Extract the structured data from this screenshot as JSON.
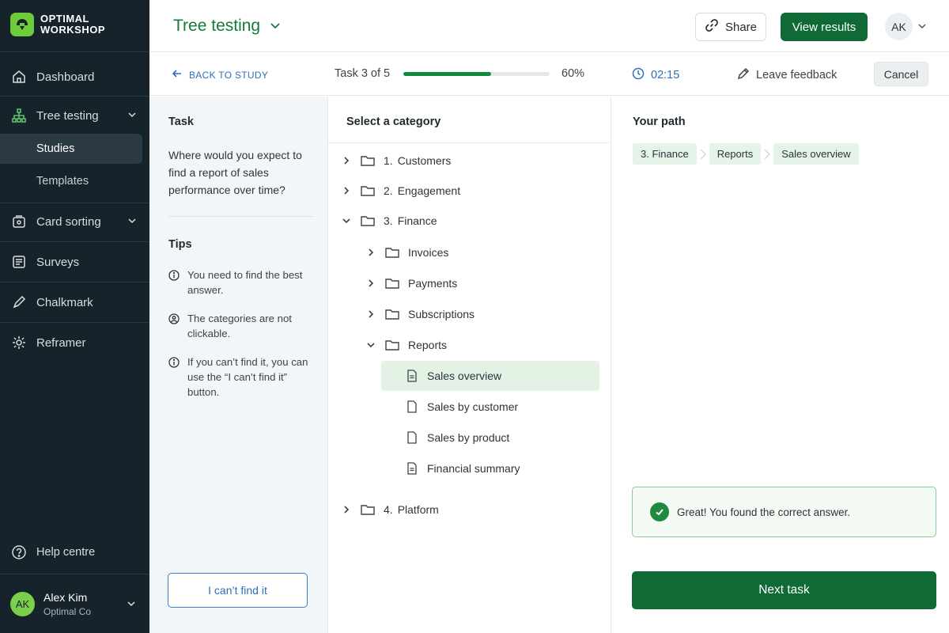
{
  "brand": {
    "line1": "OPTIMAL",
    "line2": "WORKSHOP"
  },
  "sidebar": {
    "items": [
      {
        "label": "Dashboard",
        "icon": "home-icon"
      },
      {
        "label": "Tree testing",
        "icon": "tree-icon"
      },
      {
        "label": "Card sorting",
        "icon": "cards-icon"
      },
      {
        "label": "Surveys",
        "icon": "survey-icon"
      },
      {
        "label": "Chalkmark",
        "icon": "pen-icon"
      },
      {
        "label": "Reframer",
        "icon": "reframer-icon"
      }
    ],
    "tree_sub": [
      {
        "label": "Studies"
      },
      {
        "label": "Templates"
      }
    ],
    "help": "Help centre",
    "user": {
      "initials": "AK",
      "name": "Alex Kim",
      "org": "Optimal Co"
    }
  },
  "header": {
    "title": "Tree testing",
    "share": "Share",
    "view_results": "View results",
    "avatar": "AK"
  },
  "subbar": {
    "back": "BACK TO STUDY",
    "task": "Task 3 of 5",
    "progress": 0.6,
    "progress_label": "60%",
    "timer": "02:15",
    "feedback": "Leave feedback",
    "cancel": "Cancel"
  },
  "task_panel": {
    "heading": "Task",
    "text": "Where would you expect to find a report of sales performance over time?",
    "tips_heading": "Tips",
    "tips": [
      "You need to find the best answer.",
      "The categories are not clickable.",
      "If you can’t find it, you can use the “I can’t find it” button."
    ],
    "cant_find": "I can’t find it"
  },
  "tree": {
    "heading": "Select a category",
    "items": [
      {
        "num": "1.",
        "label": "Customers"
      },
      {
        "num": "2.",
        "label": "Engagement"
      },
      {
        "num": "3.",
        "label": "Finance"
      },
      {
        "num": "",
        "label": "Invoices"
      },
      {
        "num": "",
        "label": "Payments"
      },
      {
        "num": "",
        "label": "Subscriptions"
      },
      {
        "num": "",
        "label": "Reports"
      },
      {
        "num": "",
        "label": "Sales overview"
      },
      {
        "num": "",
        "label": "Sales by customer"
      },
      {
        "num": "",
        "label": "Sales by product"
      },
      {
        "num": "",
        "label": "Financial summary"
      },
      {
        "num": "4.",
        "label": "Platform"
      }
    ],
    "selected": "Sales overview"
  },
  "path_panel": {
    "heading": "Your path",
    "crumbs": [
      "3.  Finance",
      "Reports",
      "Sales overview"
    ],
    "success": "Great! You found the correct answer.",
    "next": "Next task"
  },
  "colors": {
    "brand_green": "#0f6a36",
    "accent_blue": "#2f6fb5",
    "sidebar_bg": "#16232b"
  }
}
